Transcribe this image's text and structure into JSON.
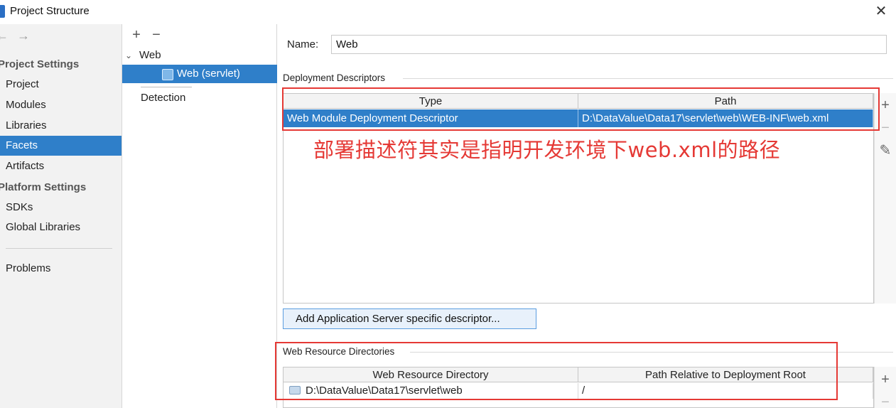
{
  "window": {
    "title": "Project Structure",
    "close_glyph": "✕"
  },
  "nav": {
    "back_glyph": "←",
    "forward_glyph": "→",
    "project_settings_header": "Project Settings",
    "platform_settings_header": "Platform Settings",
    "items": [
      {
        "label": "Project"
      },
      {
        "label": "Modules"
      },
      {
        "label": "Libraries"
      },
      {
        "label": "Facets"
      },
      {
        "label": "Artifacts"
      },
      {
        "label": "SDKs"
      },
      {
        "label": "Global Libraries"
      },
      {
        "label": "Problems"
      }
    ],
    "selected": "Facets"
  },
  "tree": {
    "add_glyph": "+",
    "remove_glyph": "−",
    "root_label": "Web",
    "child_label": "Web (servlet)",
    "detection_label": "Detection"
  },
  "facet": {
    "name_label": "Name:",
    "name_value": "Web",
    "deployment_descriptors": {
      "group_label": "Deployment Descriptors",
      "columns": [
        "Type",
        "Path"
      ],
      "rows": [
        {
          "type": "Web Module Deployment Descriptor",
          "path": "D:\\DataValue\\Data17\\servlet\\web\\WEB-INF\\web.xml"
        }
      ],
      "add_button_label": "Add Application Server specific descriptor..."
    },
    "web_resource_directories": {
      "group_label": "Web Resource Directories",
      "columns": [
        "Web Resource Directory",
        "Path Relative to Deployment Root"
      ],
      "rows": [
        {
          "directory": "D:\\DataValue\\Data17\\servlet\\web",
          "relative_path": "/"
        }
      ]
    },
    "side_tools": {
      "add": "+",
      "remove": "−",
      "edit": "✎"
    }
  },
  "annotation": {
    "text": "部署描述符其实是指明开发环境下web.xml的路径",
    "color": "#e53935"
  },
  "colors": {
    "selection": "#2f7fc9",
    "annotation_red": "#e53935"
  }
}
